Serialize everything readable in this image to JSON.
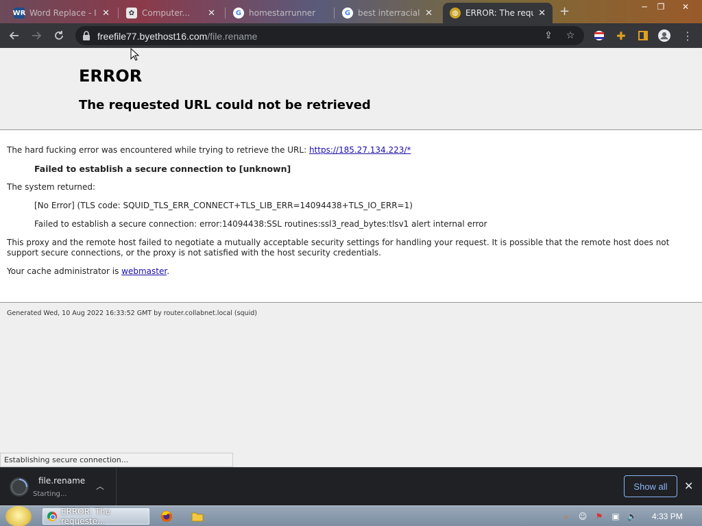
{
  "browser": {
    "tabs": [
      {
        "title": "Word Replace - I...",
        "favicon": "wr"
      },
      {
        "title": "Computer...",
        "favicon": "puzzle"
      },
      {
        "title": "homestarrunner",
        "favicon": "google"
      },
      {
        "title": "best interracial...",
        "favicon": "google"
      },
      {
        "title": "ERROR: The reque...",
        "favicon": "globe"
      }
    ],
    "url_host": "freefile77.byethost16.com",
    "url_path": "/file.rename"
  },
  "page": {
    "title": "ERROR",
    "subtitle": "The requested URL could not be retrieved",
    "intro_text": "The hard fucking error was encountered while trying to retrieve the URL: ",
    "intro_link": "https://185.27.134.223/*",
    "failed_msg": "Failed to establish a secure connection to [unknown]",
    "system_returned_label": "The system returned:",
    "system_line1": "[No Error] (TLS code: SQUID_TLS_ERR_CONNECT+TLS_LIB_ERR=14094438+TLS_IO_ERR=1)",
    "system_line2": "Failed to establish a secure connection: error:14094438:SSL routines:ssl3_read_bytes:tlsv1 alert internal error",
    "proxy_text": "This proxy and the remote host failed to negotiate a mutually acceptable security settings for handling your request. It is possible that the remote host does not support secure connections, or the proxy is not satisfied with the host security credentials.",
    "admin_text": "Your cache administrator is ",
    "admin_link": "webmaster",
    "admin_period": ".",
    "footer": "Generated Wed, 10 Aug 2022 16:33:52 GMT by router.collabnet.local (squid)"
  },
  "status_bubble": "Establishing secure connection...",
  "download": {
    "filename": "file.rename",
    "status": "Starting..."
  },
  "shelf": {
    "show_all": "Show all"
  },
  "taskbar": {
    "active_window": "ERROR: The requeste...",
    "clock": "4:33 PM"
  },
  "colors": {
    "link": "#1a0dab",
    "accent": "#8ab4f8"
  }
}
